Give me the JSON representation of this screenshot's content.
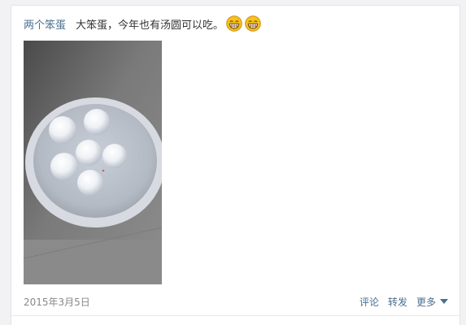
{
  "post": {
    "author": "两个笨蛋",
    "text": "大笨蛋，今年也有汤圆可以吃。",
    "emojis": [
      "grin-emoji",
      "grin-emoji"
    ],
    "photo": "bowl-of-tangyuan"
  },
  "footer": {
    "date": "2015年3月5日",
    "comment_label": "评论",
    "forward_label": "转发",
    "more_label": "更多"
  },
  "colors": {
    "link": "#4a6f8f",
    "text": "#333333",
    "meta": "#888888",
    "emoji_yellow": "#f6c21c"
  }
}
